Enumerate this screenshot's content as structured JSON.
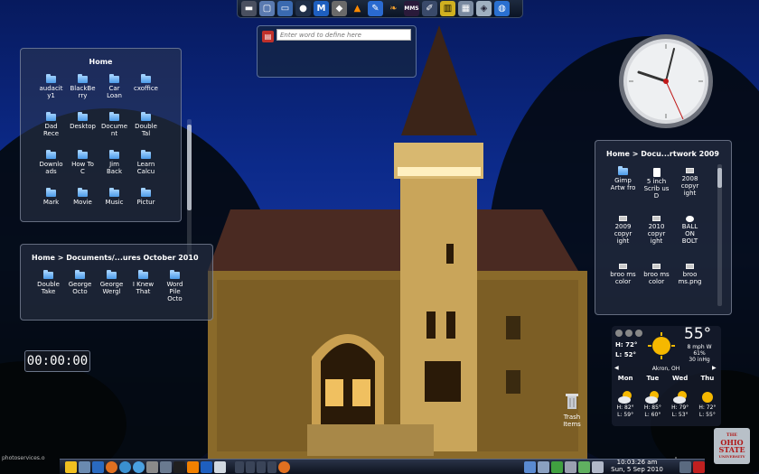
{
  "top_bar": {
    "icons": [
      "drive-icon",
      "window-icon",
      "monitor-icon",
      "planet-icon",
      "m-app-icon",
      "helmet-icon",
      "vlc-icon",
      "pen-icon",
      "feather-icon",
      "mms-icon",
      "notepad-icon",
      "film-icon",
      "calculator-icon",
      "cube-icon",
      "globe-icon"
    ],
    "labels": {
      "m_app": "M",
      "mms": "MMS"
    }
  },
  "dictionary": {
    "placeholder": "Enter word to define here"
  },
  "folder_home": {
    "title": "Home",
    "items": [
      {
        "label": "audacity1"
      },
      {
        "label": "BlackBerry"
      },
      {
        "label": "Car Loan"
      },
      {
        "label": "cxoffice"
      },
      {
        "label": "Dad Rece"
      },
      {
        "label": "Desktop"
      },
      {
        "label": "Document"
      },
      {
        "label": "Double Tal"
      },
      {
        "label": "Downloads"
      },
      {
        "label": "How To C"
      },
      {
        "label": "Jim Back"
      },
      {
        "label": "Learn Calcu"
      },
      {
        "label": "Mark"
      },
      {
        "label": "Movie"
      },
      {
        "label": "Music"
      },
      {
        "label": "Pictur"
      }
    ]
  },
  "folder_oct": {
    "title": "Home > Documents/...ures October 2010",
    "items": [
      {
        "label": "Double Take"
      },
      {
        "label": "George Octo"
      },
      {
        "label": "George Wergl"
      },
      {
        "label": "I Knew That"
      },
      {
        "label": "Word Pile Octo"
      }
    ]
  },
  "folder_art": {
    "title": "Home > Docu...rtwork 2009",
    "items": [
      {
        "label": "Gimp Artw fro",
        "icon": "folder"
      },
      {
        "label": "5 inch Scrib us D",
        "icon": "file"
      },
      {
        "label": "2008 copyr ight",
        "icon": "image"
      },
      {
        "label": "2009 copyr ight",
        "icon": "image"
      },
      {
        "label": "2010 copyr ight",
        "icon": "image"
      },
      {
        "label": "BALL ON BOLT",
        "icon": "bubble"
      },
      {
        "label": "broo ms color",
        "icon": "image"
      },
      {
        "label": "broo ms color",
        "icon": "image"
      },
      {
        "label": "broo ms.png",
        "icon": "image"
      }
    ]
  },
  "timer": {
    "value": "00:00:00"
  },
  "weather": {
    "current_temp": "55°",
    "high": "H: 72°",
    "low": "L: 52°",
    "wind": "8 mph W",
    "humidity": "61%",
    "pressure": "30 inHg",
    "location": "Akron, OH",
    "days": [
      "Mon",
      "Tue",
      "Wed",
      "Thu"
    ],
    "forecast": [
      {
        "high": "H: 82°",
        "low": "L: 59°",
        "icon": "cloudy-sun-icon"
      },
      {
        "high": "H: 85°",
        "low": "L: 60°",
        "icon": "cloudy-sun-icon"
      },
      {
        "high": "H: 79°",
        "low": "L: 53°",
        "icon": "cloudy-sun-icon"
      },
      {
        "high": "H: 72°",
        "low": "L: 55°",
        "icon": "sun-icon"
      }
    ]
  },
  "trash": {
    "label": "Trash Items"
  },
  "panel": {
    "time": "10:03:26 am",
    "date": "Sun, 5 Sep 2010",
    "watermark_left": "photoservices.o",
    "watermark_right": "edu"
  },
  "logo": {
    "line1": "THE",
    "line2": "OHIO",
    "line3": "STATE",
    "line4": "UNIVERSITY"
  },
  "colors": {
    "accent": "#4c9be8",
    "panel": "#1d2a3f",
    "sun": "#f5b800"
  }
}
